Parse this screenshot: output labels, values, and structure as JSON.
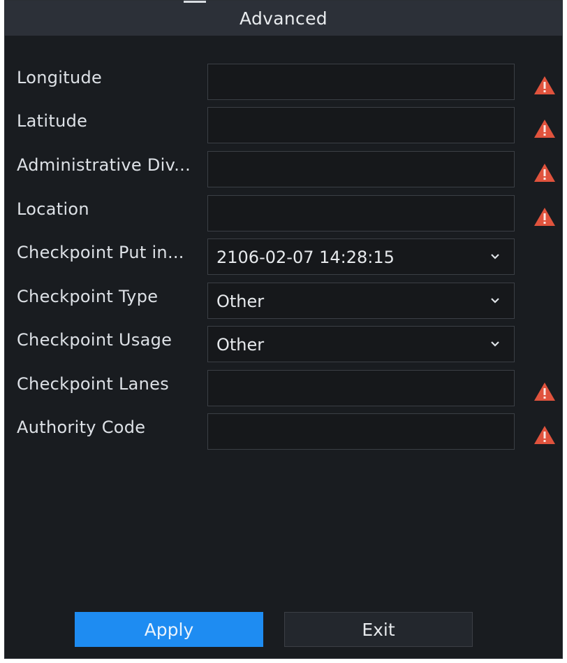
{
  "dialog": {
    "title": "Advanced"
  },
  "fields": [
    {
      "label": "Longitude",
      "type": "text",
      "value": "",
      "warning": true
    },
    {
      "label": "Latitude",
      "type": "text",
      "value": "",
      "warning": true
    },
    {
      "label": "Administrative Div...",
      "type": "text",
      "value": "",
      "warning": true
    },
    {
      "label": "Location",
      "type": "text",
      "value": "",
      "warning": true
    },
    {
      "label": "Checkpoint Put in...",
      "type": "select",
      "value": "2106-02-07 14:28:15",
      "warning": false
    },
    {
      "label": "Checkpoint Type",
      "type": "select",
      "value": "Other",
      "warning": false
    },
    {
      "label": "Checkpoint Usage",
      "type": "select",
      "value": "Other",
      "warning": false
    },
    {
      "label": "Checkpoint Lanes",
      "type": "text",
      "value": "",
      "warning": true
    },
    {
      "label": "Authority Code",
      "type": "text",
      "value": "",
      "warning": true
    }
  ],
  "buttons": {
    "apply_label": "Apply",
    "exit_label": "Exit"
  },
  "colors": {
    "background": "#191c20",
    "titlebar": "#2c3038",
    "accent": "#1e8cf2",
    "warning": "#e0533d"
  },
  "icons": {
    "warning": "warning-triangle-icon",
    "dropdown": "chevron-down-icon"
  }
}
